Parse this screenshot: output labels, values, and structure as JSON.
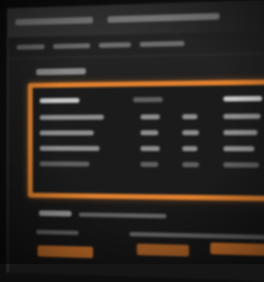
{
  "theme": {
    "background": "#0e0e0e",
    "window": "#1d1d1d",
    "accent": "#e1812f",
    "accent_button": "#c8702a"
  },
  "panel": {
    "rows": 5
  },
  "buttons": [
    {
      "name": "left-action-button"
    },
    {
      "name": "center-action-button"
    },
    {
      "name": "right-action-button"
    }
  ]
}
